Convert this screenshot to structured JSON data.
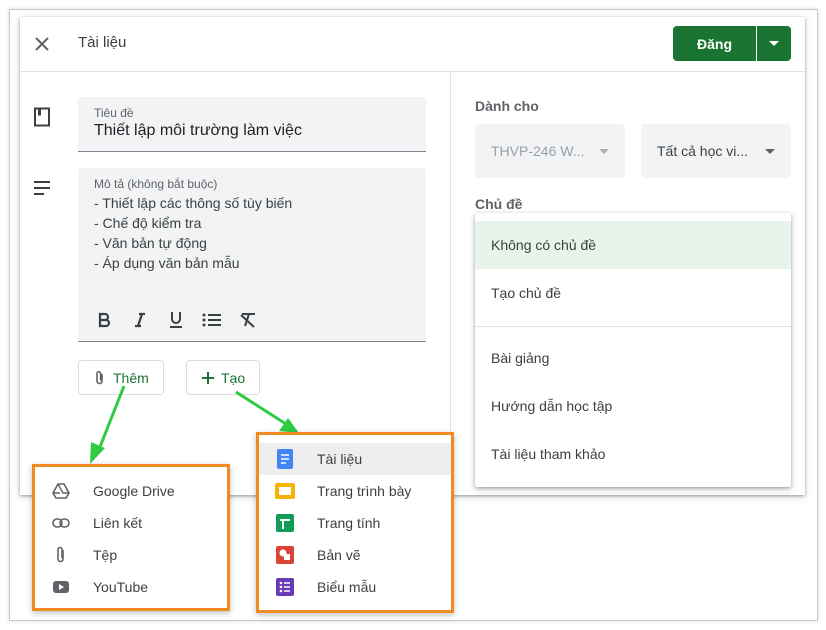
{
  "dialog": {
    "title": "Tài liệu",
    "post_label": "Đăng"
  },
  "form": {
    "title_label": "Tiêu đề",
    "title_value": "Thiết lập môi trường làm việc",
    "desc_label": "Mô tả (không bắt buộc)",
    "desc_lines": [
      "- Thiết lập các thông số tùy biến",
      "- Chế độ kiểm tra",
      "- Văn bản tự động",
      "- Áp dụng văn bản mẫu"
    ],
    "format_icons": [
      "bold-icon",
      "italic-icon",
      "underline-icon",
      "bulleted-list-icon",
      "clear-format-icon"
    ],
    "add_label": "Thêm",
    "create_label": "Tạo"
  },
  "sidebar": {
    "for_label": "Dành cho",
    "class_value": "THVP-246 W...",
    "students_value": "Tất cả học vi...",
    "topic_label": "Chủ đề"
  },
  "topic_menu": {
    "items": [
      {
        "label": "Không có chủ đề",
        "selected": true
      },
      {
        "label": "Tạo chủ đề",
        "selected": false
      },
      {
        "label": "Bài giảng",
        "selected": false
      },
      {
        "label": "Hướng dẫn học tập",
        "selected": false
      },
      {
        "label": "Tài liệu tham khảo",
        "selected": false
      }
    ]
  },
  "add_menu": {
    "items": [
      {
        "label": "Google Drive",
        "icon": "drive-icon"
      },
      {
        "label": "Liên kết",
        "icon": "link-icon"
      },
      {
        "label": "Tệp",
        "icon": "attachment-icon"
      },
      {
        "label": "YouTube",
        "icon": "youtube-icon"
      }
    ]
  },
  "create_menu": {
    "items": [
      {
        "label": "Tài liệu",
        "icon": "docs-icon",
        "color": "#4285f4"
      },
      {
        "label": "Trang trình bày",
        "icon": "slides-icon",
        "color": "#f4b400"
      },
      {
        "label": "Trang tính",
        "icon": "sheets-icon",
        "color": "#0f9d58"
      },
      {
        "label": "Bản vẽ",
        "icon": "drawings-icon",
        "color": "#db4437"
      },
      {
        "label": "Biểu mẫu",
        "icon": "forms-icon",
        "color": "#673ab7"
      }
    ]
  },
  "colors": {
    "accent": "#1a7431",
    "callout": "#f08a24",
    "arrow": "#2ecc40"
  }
}
